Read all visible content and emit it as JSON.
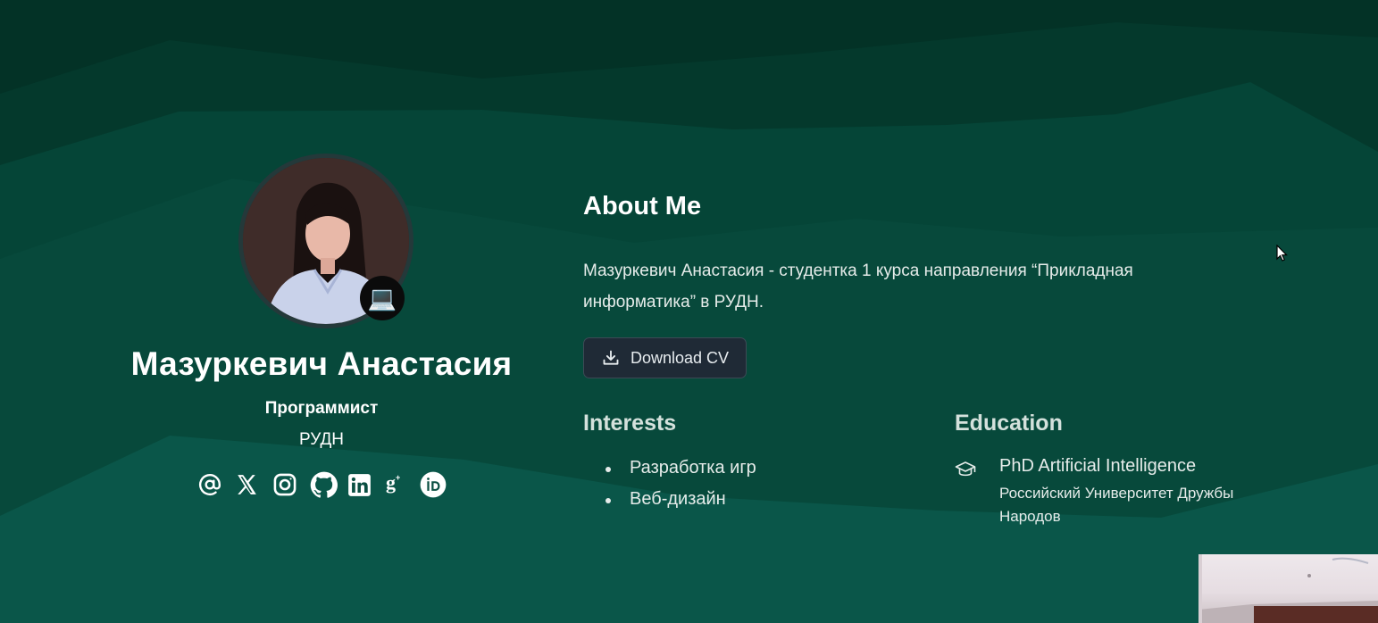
{
  "theme": {
    "bg_dark": "#033226",
    "bg_mid": "#05463a",
    "bg_light": "#0b5a4c",
    "button_bg": "#1f2a36"
  },
  "profile": {
    "photo_alt": "profile photo",
    "badge_emoji": "💻",
    "name": "Мазуркевич Анастасия",
    "role": "Программист",
    "organization": "РУДН",
    "socials": [
      {
        "icon": "at-sign-icon"
      },
      {
        "icon": "x-twitter-icon"
      },
      {
        "icon": "instagram-icon"
      },
      {
        "icon": "github-icon"
      },
      {
        "icon": "linkedin-icon"
      },
      {
        "icon": "google-scholar-icon"
      },
      {
        "icon": "orcid-icon"
      }
    ]
  },
  "about": {
    "title": "About Me",
    "text": "Мазуркевич Анастасия - студентка 1 курса направления “Прикладная информатика” в РУДН.",
    "cv_button": "Download CV",
    "cv_icon": "download-icon"
  },
  "interests": {
    "title": "Interests",
    "items": [
      "Разработка игр",
      "Веб-дизайн"
    ]
  },
  "education": {
    "title": "Education",
    "icon": "graduation-cap-icon",
    "degree": "PhD Artificial Intelligence",
    "university": "Российский Университет Дружбы Народов"
  }
}
